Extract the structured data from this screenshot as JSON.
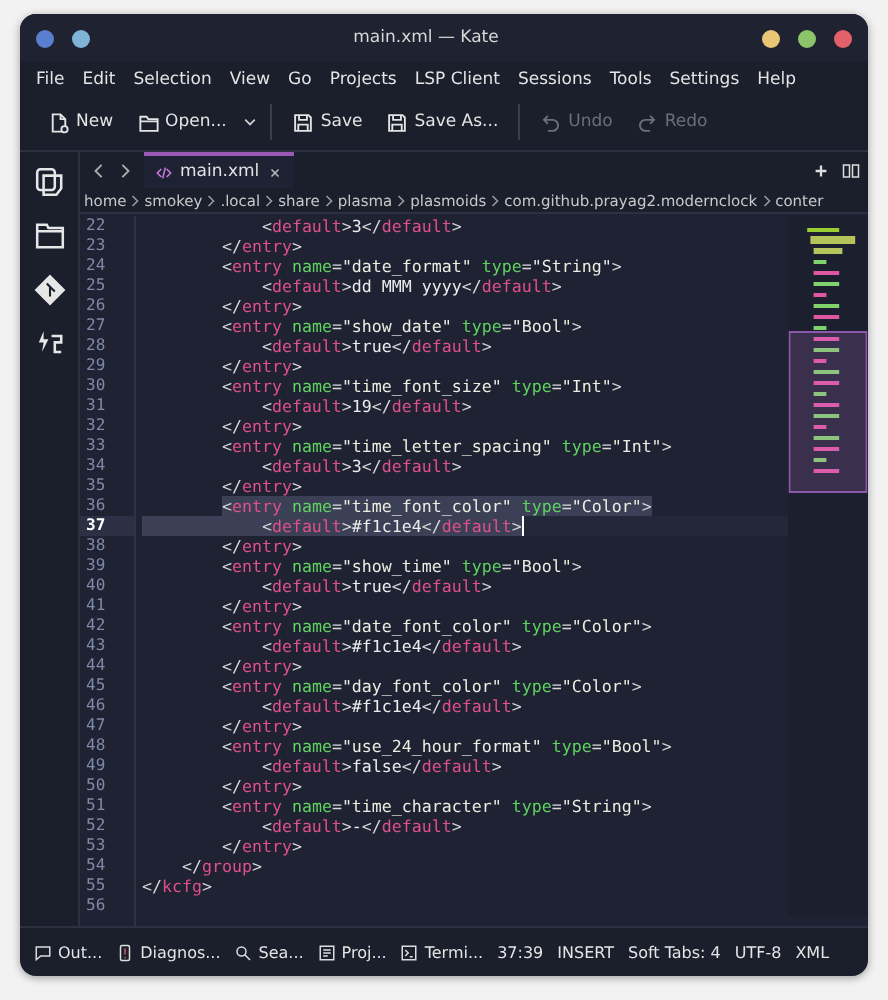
{
  "window": {
    "title": "main.xml — Kate"
  },
  "menu": [
    "File",
    "Edit",
    "Selection",
    "View",
    "Go",
    "Projects",
    "LSP Client",
    "Sessions",
    "Tools",
    "Settings",
    "Help"
  ],
  "toolbar": [
    {
      "kind": "new",
      "label": "New",
      "disabled": false,
      "dropdown": false
    },
    {
      "kind": "open",
      "label": "Open...",
      "disabled": false,
      "dropdown": true
    },
    {
      "kind": "save",
      "label": "Save",
      "disabled": false,
      "dropdown": false
    },
    {
      "kind": "saveas",
      "label": "Save As...",
      "disabled": false,
      "dropdown": false
    },
    {
      "kind": "undo",
      "label": "Undo",
      "disabled": true,
      "dropdown": false
    },
    {
      "kind": "redo",
      "label": "Redo",
      "disabled": true,
      "dropdown": false
    }
  ],
  "sidebar": [
    {
      "kind": "documents"
    },
    {
      "kind": "folder"
    },
    {
      "kind": "git"
    },
    {
      "kind": "plugin"
    }
  ],
  "tabs": [
    {
      "label": "main.xml",
      "selected": true
    }
  ],
  "breadcrumb": [
    "home",
    "smokey",
    ".local",
    "share",
    "plasma",
    "plasmoids",
    "com.github.prayag2.modernclock",
    "conter"
  ],
  "editor": {
    "lines": [
      {
        "number": "22",
        "text": "            <default>3</default>",
        "selected": false,
        "current": false
      },
      {
        "number": "23",
        "text": "        </entry>",
        "selected": false,
        "current": false
      },
      {
        "number": "24",
        "text": "        <entry name=\"date_format\" type=\"String\">",
        "selected": false,
        "current": false
      },
      {
        "number": "25",
        "text": "            <default>dd MMM yyyy</default>",
        "selected": false,
        "current": false
      },
      {
        "number": "26",
        "text": "        </entry>",
        "selected": false,
        "current": false
      },
      {
        "number": "27",
        "text": "        <entry name=\"show_date\" type=\"Bool\">",
        "selected": false,
        "current": false
      },
      {
        "number": "28",
        "text": "            <default>true</default>",
        "selected": false,
        "current": false
      },
      {
        "number": "29",
        "text": "        </entry>",
        "selected": false,
        "current": false
      },
      {
        "number": "30",
        "text": "        <entry name=\"time_font_size\" type=\"Int\">",
        "selected": false,
        "current": false
      },
      {
        "number": "31",
        "text": "            <default>19</default>",
        "selected": false,
        "current": false
      },
      {
        "number": "32",
        "text": "        </entry>",
        "selected": false,
        "current": false
      },
      {
        "number": "33",
        "text": "        <entry name=\"time_letter_spacing\" type=\"Int\">",
        "selected": false,
        "current": false
      },
      {
        "number": "34",
        "text": "            <default>3</default>",
        "selected": false,
        "current": false
      },
      {
        "number": "35",
        "text": "        </entry>",
        "selected": false,
        "current": false
      },
      {
        "number": "36",
        "text": "        <entry name=\"time_font_color\" type=\"Color\">",
        "selected": true,
        "current": false
      },
      {
        "number": "37",
        "text": "            <default>#f1c1e4</default>",
        "selected": true,
        "current": true
      },
      {
        "number": "38",
        "text": "        </entry>",
        "selected": false,
        "current": false
      },
      {
        "number": "39",
        "text": "        <entry name=\"show_time\" type=\"Bool\">",
        "selected": false,
        "current": false
      },
      {
        "number": "40",
        "text": "            <default>true</default>",
        "selected": false,
        "current": false
      },
      {
        "number": "41",
        "text": "        </entry>",
        "selected": false,
        "current": false
      },
      {
        "number": "42",
        "text": "        <entry name=\"date_font_color\" type=\"Color\">",
        "selected": false,
        "current": false
      },
      {
        "number": "43",
        "text": "            <default>#f1c1e4</default>",
        "selected": false,
        "current": false
      },
      {
        "number": "44",
        "text": "        </entry>",
        "selected": false,
        "current": false
      },
      {
        "number": "45",
        "text": "        <entry name=\"day_font_color\" type=\"Color\">",
        "selected": false,
        "current": false
      },
      {
        "number": "46",
        "text": "            <default>#f1c1e4</default>",
        "selected": false,
        "current": false
      },
      {
        "number": "47",
        "text": "        </entry>",
        "selected": false,
        "current": false
      },
      {
        "number": "48",
        "text": "        <entry name=\"use_24_hour_format\" type=\"Bool\">",
        "selected": false,
        "current": false
      },
      {
        "number": "49",
        "text": "            <default>false</default>",
        "selected": false,
        "current": false
      },
      {
        "number": "50",
        "text": "        </entry>",
        "selected": false,
        "current": false
      },
      {
        "number": "51",
        "text": "        <entry name=\"time_character\" type=\"String\">",
        "selected": false,
        "current": false
      },
      {
        "number": "52",
        "text": "            <default>-</default>",
        "selected": false,
        "current": false
      },
      {
        "number": "53",
        "text": "        </entry>",
        "selected": false,
        "current": false
      },
      {
        "number": "54",
        "text": "    </group>",
        "selected": false,
        "current": false
      },
      {
        "number": "55",
        "text": "</kcfg>",
        "selected": false,
        "current": false
      },
      {
        "number": "56",
        "selected": false,
        "current": false
      }
    ]
  },
  "status_bar": {
    "panels": [
      {
        "kind": "output",
        "label": "Out..."
      },
      {
        "kind": "diagnostics",
        "label": "Diagnos..."
      },
      {
        "kind": "search",
        "label": "Sea..."
      },
      {
        "kind": "project",
        "label": "Proj..."
      },
      {
        "kind": "terminal",
        "label": "Termi..."
      }
    ],
    "position": "37:39",
    "mode": "INSERT",
    "indent": "Soft Tabs: 4",
    "encoding": "UTF-8",
    "syntax": "XML"
  }
}
